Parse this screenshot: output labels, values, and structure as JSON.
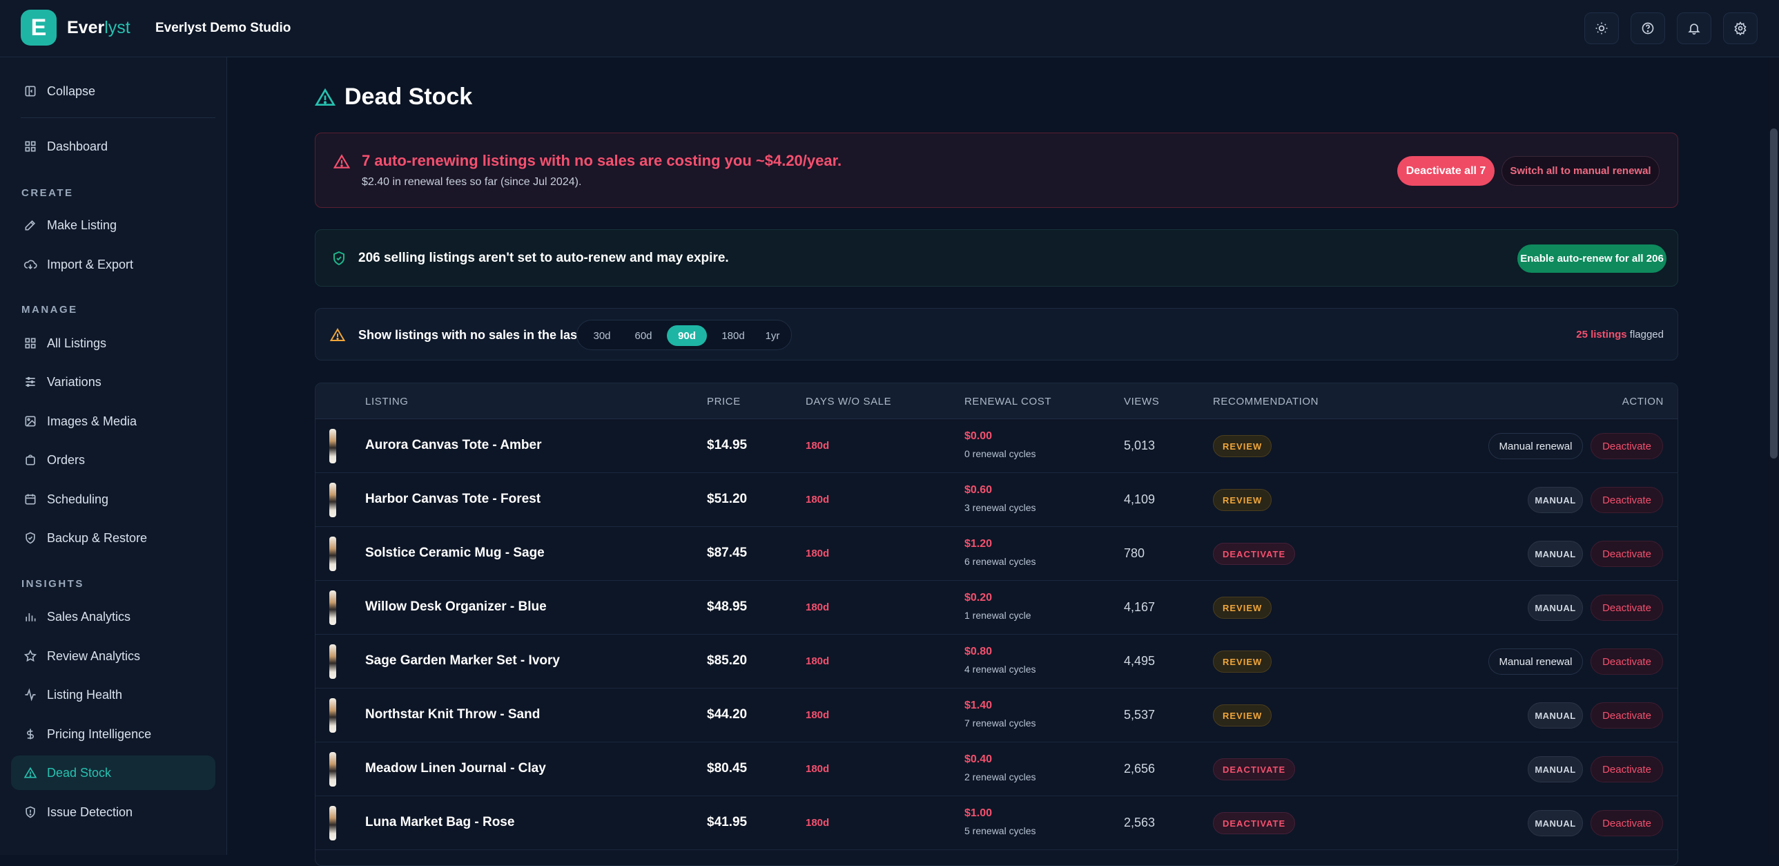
{
  "app": {
    "logo_letter": "E",
    "brand_prefix": "Ever",
    "brand_suffix": "lyst",
    "studio": "Everlyst Demo Studio"
  },
  "sidebar": {
    "collapse": "Collapse",
    "dashboard": "Dashboard",
    "sections": {
      "create": "CREATE",
      "manage": "MANAGE",
      "insights": "INSIGHTS"
    },
    "create": [
      "Make Listing",
      "Import & Export"
    ],
    "manage": [
      "All Listings",
      "Variations",
      "Images & Media",
      "Orders",
      "Scheduling",
      "Backup & Restore"
    ],
    "insights": [
      "Sales Analytics",
      "Review Analytics",
      "Listing Health",
      "Pricing Intelligence",
      "Dead Stock",
      "Issue Detection"
    ],
    "active": "Dead Stock"
  },
  "page": {
    "title": "Dead Stock"
  },
  "alert_red": {
    "headline": "7 auto-renewing listings with no sales are costing you ~$4.20/year.",
    "sub": "$2.40 in renewal fees so far (since Jul 2024).",
    "primary_button": "Deactivate all 7",
    "secondary_button": "Switch all to manual renewal"
  },
  "alert_green": {
    "headline": "206 selling listings aren't set to auto-renew and may expire.",
    "button": "Enable auto-renew for all 206"
  },
  "filter": {
    "label": "Show listings with no sales in the last:",
    "options": [
      "30d",
      "60d",
      "90d",
      "180d",
      "1yr"
    ],
    "selected": "90d",
    "flagged_count": "25 listings",
    "flagged_suffix": "flagged"
  },
  "table": {
    "columns": [
      "LISTING",
      "PRICE",
      "DAYS W/O SALE",
      "RENEWAL COST",
      "VIEWS",
      "RECOMMENDATION",
      "ACTION"
    ],
    "rows": [
      {
        "name": "Aurora Canvas Tote - Amber",
        "price": "$14.95",
        "days": "180d",
        "cost": "$0.00",
        "cycles": "0 renewal cycles",
        "views": "5,013",
        "rec": "REVIEW",
        "action": "Manual renewal",
        "deactivate": "Deactivate"
      },
      {
        "name": "Harbor Canvas Tote - Forest",
        "price": "$51.20",
        "days": "180d",
        "cost": "$0.60",
        "cycles": "3 renewal cycles",
        "views": "4,109",
        "rec": "REVIEW",
        "action": "MANUAL",
        "deactivate": "Deactivate"
      },
      {
        "name": "Solstice Ceramic Mug - Sage",
        "price": "$87.45",
        "days": "180d",
        "cost": "$1.20",
        "cycles": "6 renewal cycles",
        "views": "780",
        "rec": "DEACTIVATE",
        "action": "MANUAL",
        "deactivate": "Deactivate"
      },
      {
        "name": "Willow Desk Organizer - Blue",
        "price": "$48.95",
        "days": "180d",
        "cost": "$0.20",
        "cycles": "1 renewal cycle",
        "views": "4,167",
        "rec": "REVIEW",
        "action": "MANUAL",
        "deactivate": "Deactivate"
      },
      {
        "name": "Sage Garden Marker Set - Ivory",
        "price": "$85.20",
        "days": "180d",
        "cost": "$0.80",
        "cycles": "4 renewal cycles",
        "views": "4,495",
        "rec": "REVIEW",
        "action": "Manual renewal",
        "deactivate": "Deactivate"
      },
      {
        "name": "Northstar Knit Throw - Sand",
        "price": "$44.20",
        "days": "180d",
        "cost": "$1.40",
        "cycles": "7 renewal cycles",
        "views": "5,537",
        "rec": "REVIEW",
        "action": "MANUAL",
        "deactivate": "Deactivate"
      },
      {
        "name": "Meadow Linen Journal - Clay",
        "price": "$80.45",
        "days": "180d",
        "cost": "$0.40",
        "cycles": "2 renewal cycles",
        "views": "2,656",
        "rec": "DEACTIVATE",
        "action": "MANUAL",
        "deactivate": "Deactivate"
      },
      {
        "name": "Luna Market Bag - Rose",
        "price": "$41.95",
        "days": "180d",
        "cost": "$1.00",
        "cycles": "5 renewal cycles",
        "views": "2,563",
        "rec": "DEACTIVATE",
        "action": "MANUAL",
        "deactivate": "Deactivate"
      }
    ]
  },
  "colors": {
    "accent": "#1fb5a5",
    "danger": "#f5506e",
    "warning": "#f0a63a",
    "success": "#0e8a5d"
  },
  "icons": [
    "sun-icon",
    "help-icon",
    "bell-icon",
    "gear-icon",
    "warning-triangle-icon",
    "shield-check-icon"
  ]
}
